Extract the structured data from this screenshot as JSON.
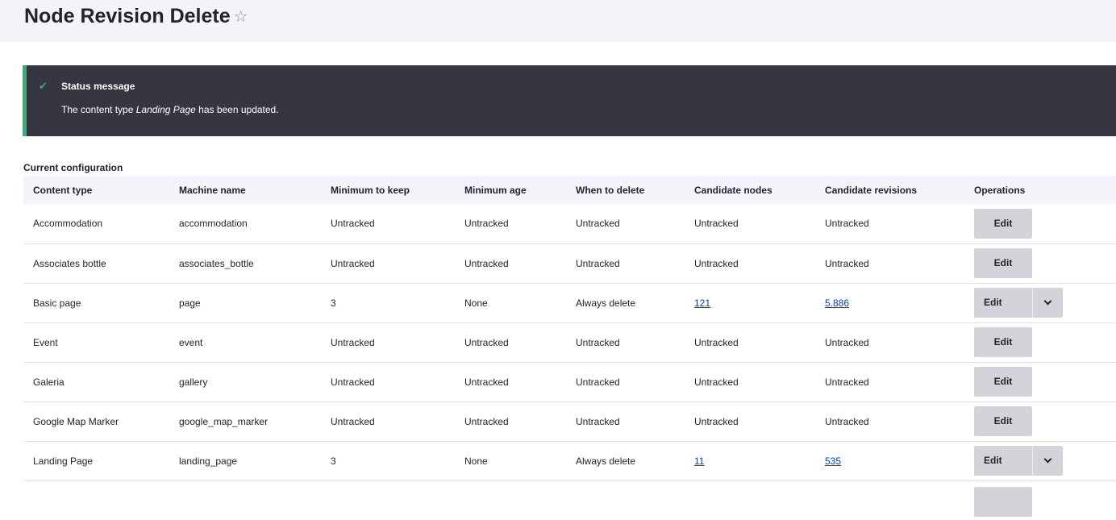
{
  "page": {
    "title": "Node Revision Delete",
    "star_glyph": "☆"
  },
  "status": {
    "check_glyph": "✔",
    "heading": "Status message",
    "text_before": "The content type ",
    "text_em": "Landing Page",
    "text_after": " has been updated."
  },
  "table": {
    "caption": "Current configuration",
    "headers": [
      "Content type",
      "Machine name",
      "Minimum to keep",
      "Minimum age",
      "When to delete",
      "Candidate nodes",
      "Candidate revisions",
      "Operations"
    ],
    "edit_label": "Edit",
    "rows": [
      {
        "type": "Accommodation",
        "machine": "accommodation",
        "min_keep": "Untracked",
        "min_age": "Untracked",
        "when": "Untracked",
        "nodes": "Untracked",
        "revisions": "Untracked"
      },
      {
        "type": "Associates bottle",
        "machine": "associates_bottle",
        "min_keep": "Untracked",
        "min_age": "Untracked",
        "when": "Untracked",
        "nodes": "Untracked",
        "revisions": "Untracked"
      },
      {
        "type": "Basic page",
        "machine": "page",
        "min_keep": "3",
        "min_age": "None",
        "when": "Always delete",
        "nodes": "121",
        "revisions": "5.886"
      },
      {
        "type": "Event",
        "machine": "event",
        "min_keep": "Untracked",
        "min_age": "Untracked",
        "when": "Untracked",
        "nodes": "Untracked",
        "revisions": "Untracked"
      },
      {
        "type": "Galeria",
        "machine": "gallery",
        "min_keep": "Untracked",
        "min_age": "Untracked",
        "when": "Untracked",
        "nodes": "Untracked",
        "revisions": "Untracked"
      },
      {
        "type": "Google Map Marker",
        "machine": "google_map_marker",
        "min_keep": "Untracked",
        "min_age": "Untracked",
        "when": "Untracked",
        "nodes": "Untracked",
        "revisions": "Untracked"
      },
      {
        "type": "Landing Page",
        "machine": "landing_page",
        "min_keep": "3",
        "min_age": "None",
        "when": "Always delete",
        "nodes": "11",
        "revisions": "535"
      }
    ]
  }
}
